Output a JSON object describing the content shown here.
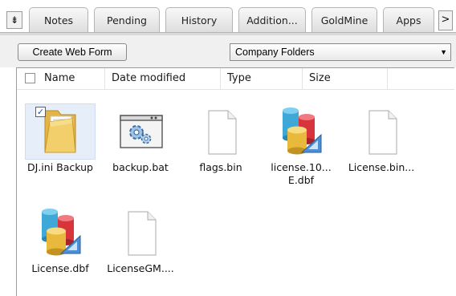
{
  "tabs": {
    "menu_glyph": "⇟",
    "items": [
      {
        "label": "Notes"
      },
      {
        "label": "Pending"
      },
      {
        "label": "History"
      },
      {
        "label": "Addition..."
      },
      {
        "label": "GoldMine"
      },
      {
        "label": "Apps"
      }
    ],
    "scroll_glyph": ">"
  },
  "toolbar": {
    "create_label": "Create Web Form",
    "folder_select": "Company Folders"
  },
  "columns": {
    "name": "Name",
    "date": "Date modified",
    "type": "Type",
    "size": "Size"
  },
  "files": [
    {
      "name": "DJ.ini Backup",
      "icon": "folder-icon",
      "selected": true
    },
    {
      "name": "backup.bat",
      "icon": "batch-file-icon"
    },
    {
      "name": "flags.bin",
      "icon": "blank-file-icon"
    },
    {
      "name": "license.10...",
      "name2": "E.dbf",
      "icon": "database-icon"
    },
    {
      "name": "License.bin...",
      "icon": "blank-file-icon"
    },
    {
      "name": "License.dbf",
      "icon": "database-icon"
    },
    {
      "name": "LicenseGM....",
      "icon": "blank-file-icon"
    }
  ],
  "colors": {
    "selection": "#e5eef9",
    "folder": "#f2cf6b",
    "db_blue": "#3fa8d6",
    "db_red": "#d8343c",
    "db_yellow": "#e8b93a"
  }
}
